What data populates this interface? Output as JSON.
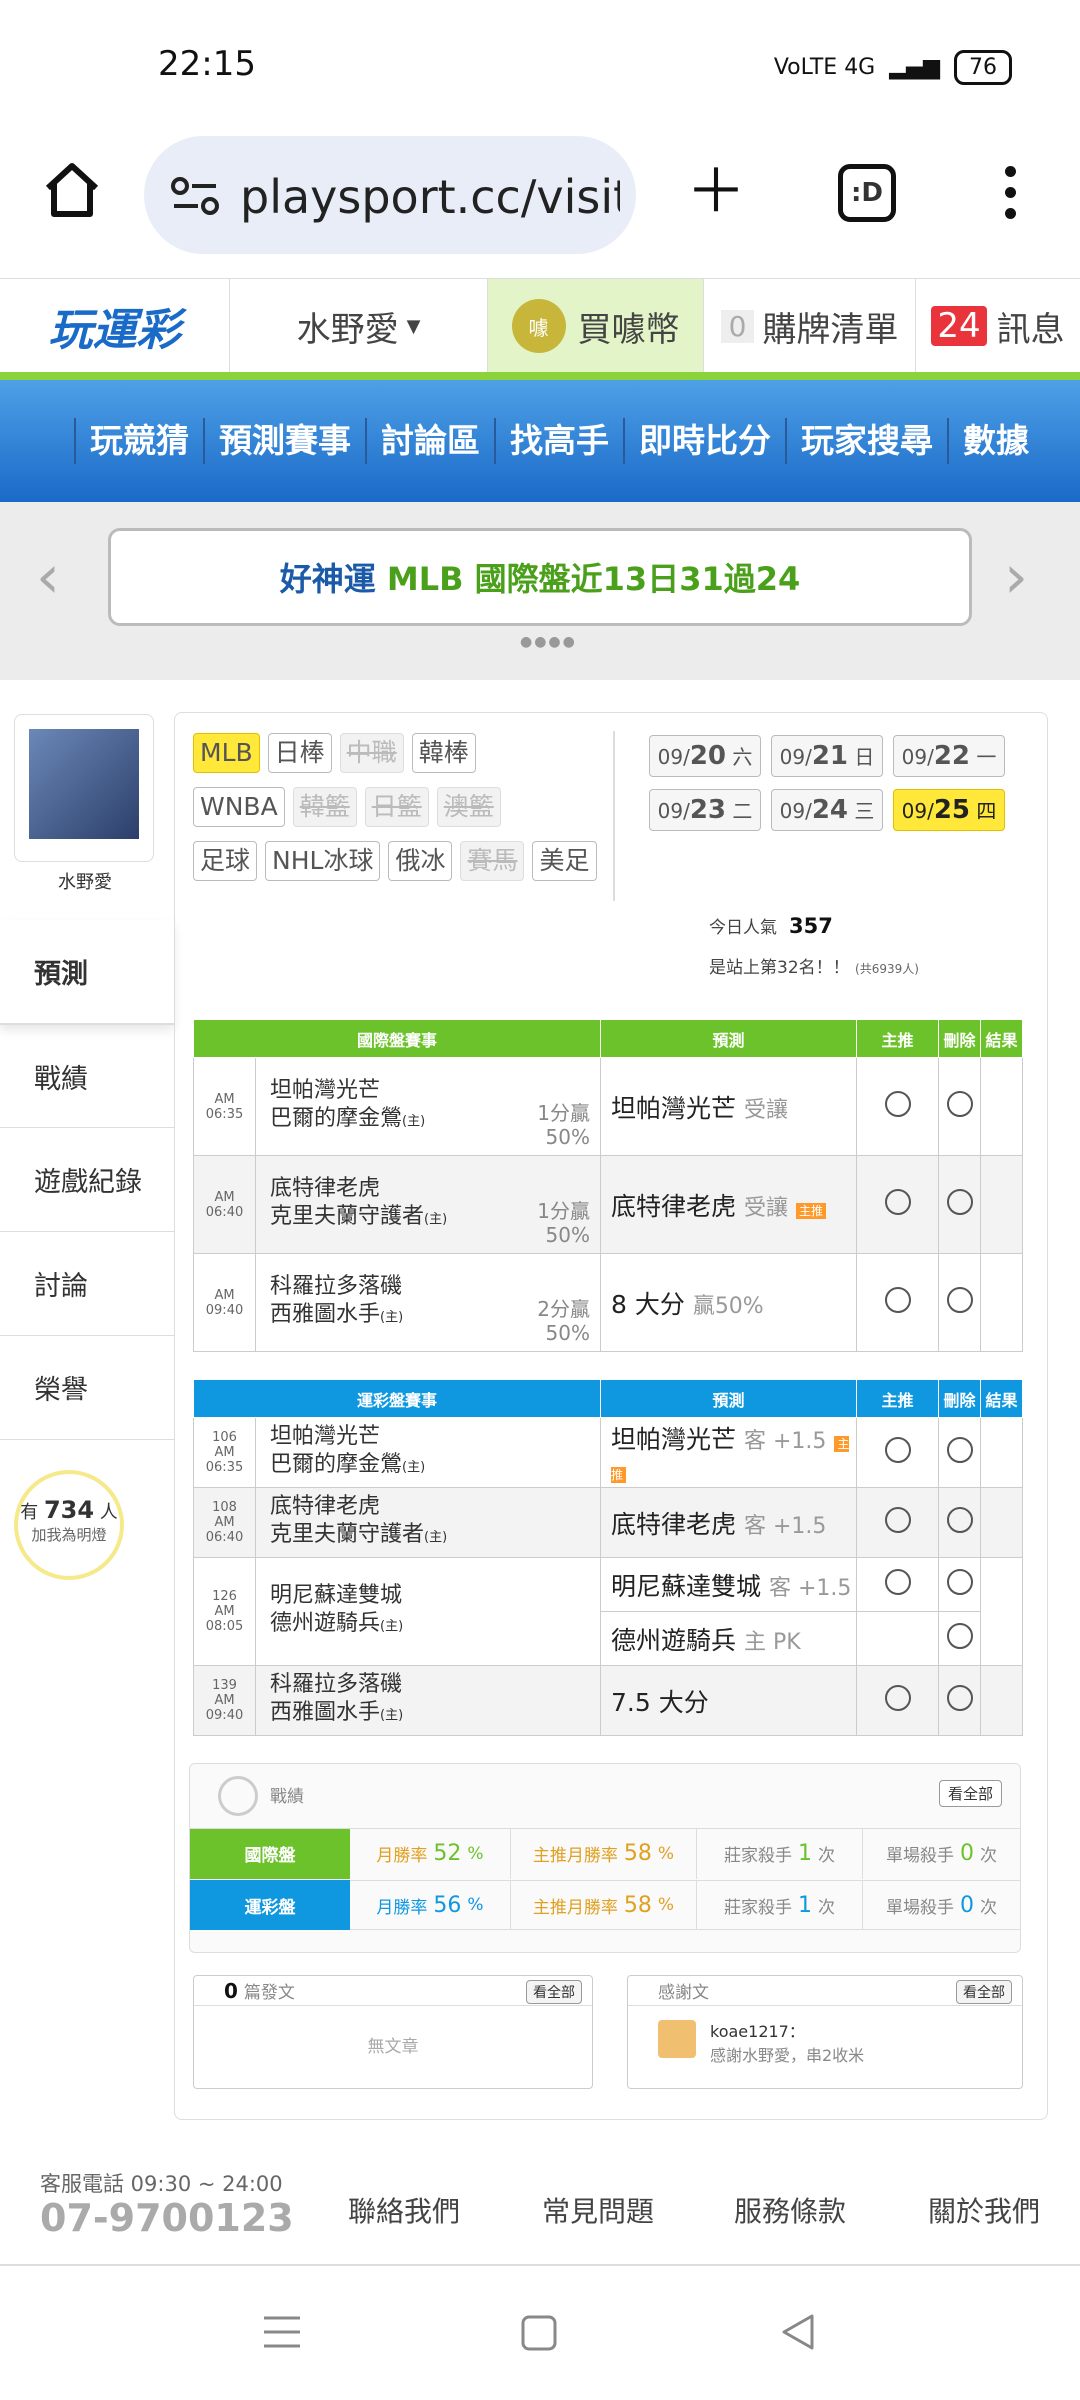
{
  "status_bar": {
    "time": "22:15",
    "network": "VoLTE 4G",
    "battery": "76"
  },
  "browser": {
    "url": "playsport.cc/visit",
    "tabs_label": ":D"
  },
  "header": {
    "logo": "玩運彩",
    "user_name": "水野愛",
    "coins_label": "買噱幣",
    "coins_badge": "噱",
    "cart_count": "0",
    "cart_label": "購牌清單",
    "msg_count": "24",
    "msg_label": "訊息"
  },
  "nav": [
    "玩競猜",
    "預測賽事",
    "討論區",
    "找高手",
    "即時比分",
    "玩家搜尋",
    "數據"
  ],
  "banner": {
    "text_a": "好神運",
    "text_b": "MLB 國際盤近13日31過24",
    "dots": "●●●●"
  },
  "profile": {
    "name": "水野愛"
  },
  "sidebar": [
    "預測",
    "戰績",
    "遊戲紀錄",
    "討論",
    "榮譽"
  ],
  "fans": {
    "prefix": "有",
    "count": "734",
    "suffix": "人",
    "line2": "加我為明燈"
  },
  "leagues": [
    {
      "label": "MLB",
      "state": "selected"
    },
    {
      "label": "日棒",
      "state": "normal"
    },
    {
      "label": "中職",
      "state": "disabled"
    },
    {
      "label": "韓棒",
      "state": "normal"
    },
    {
      "label": "WNBA",
      "state": "normal"
    },
    {
      "label": "韓籃",
      "state": "disabled"
    },
    {
      "label": "日籃",
      "state": "disabled"
    },
    {
      "label": "澳籃",
      "state": "disabled"
    },
    {
      "label": "足球",
      "state": "normal"
    },
    {
      "label": "NHL冰球",
      "state": "normal"
    },
    {
      "label": "俄冰",
      "state": "normal"
    },
    {
      "label": "賽馬",
      "state": "disabled"
    },
    {
      "label": "美足",
      "state": "normal"
    }
  ],
  "dates": [
    {
      "m": "09/",
      "d": "20",
      "w": "六"
    },
    {
      "m": "09/",
      "d": "21",
      "w": "日"
    },
    {
      "m": "09/",
      "d": "22",
      "w": "一"
    },
    {
      "m": "09/",
      "d": "23",
      "w": "二"
    },
    {
      "m": "09/",
      "d": "24",
      "w": "三"
    },
    {
      "m": "09/",
      "d": "25",
      "w": "四",
      "selected": true
    }
  ],
  "popularity": {
    "label": "今日人氣",
    "value": "357",
    "rank": "是站上第32名！！",
    "total": "(共6939人)"
  },
  "intl_table": {
    "headers": [
      "國際盤賽事",
      "預測",
      "主推",
      "刪除",
      "結果"
    ],
    "rows": [
      {
        "time": "AM 06:35",
        "away": "坦帕灣光芒",
        "home": "巴爾的摩金鶯",
        "home_tag": "(主)",
        "odds1": "1分贏",
        "odds2": "50%",
        "pred": "坦帕灣光芒",
        "pred_note": "受讓",
        "tag": ""
      },
      {
        "time": "AM 06:40",
        "away": "底特律老虎",
        "home": "克里夫蘭守護者",
        "home_tag": "(主)",
        "odds1": "1分贏",
        "odds2": "50%",
        "pred": "底特律老虎",
        "pred_note": "受讓",
        "tag": "主推"
      },
      {
        "time": "AM 09:40",
        "away": "科羅拉多落磯",
        "home": "西雅圖水手",
        "home_tag": "(主)",
        "odds1": "2分贏",
        "odds2": "50%",
        "pred": "8 大分",
        "pred_note": "贏50%",
        "tag": ""
      }
    ]
  },
  "lottery_table": {
    "headers": [
      "運彩盤賽事",
      "預測",
      "主推",
      "刪除",
      "結果"
    ],
    "rows": [
      {
        "num": "106",
        "time": "AM 06:35",
        "away": "坦帕灣光芒",
        "home": "巴爾的摩金鶯",
        "home_tag": "(主)",
        "preds": [
          {
            "pred": "坦帕灣光芒",
            "note": "客 +1.5",
            "tag": "主推"
          }
        ]
      },
      {
        "num": "108",
        "time": "AM 06:40",
        "away": "底特律老虎",
        "home": "克里夫蘭守護者",
        "home_tag": "(主)",
        "preds": [
          {
            "pred": "底特律老虎",
            "note": "客 +1.5",
            "tag": ""
          }
        ]
      },
      {
        "num": "126",
        "time": "AM 08:05",
        "away": "明尼蘇達雙城",
        "home": "德州遊騎兵",
        "home_tag": "(主)",
        "preds": [
          {
            "pred": "明尼蘇達雙城",
            "note": "客 +1.5",
            "tag": ""
          },
          {
            "pred": "德州遊騎兵",
            "note": "主 PK",
            "tag": ""
          }
        ]
      },
      {
        "num": "139",
        "time": "AM 09:40",
        "away": "科羅拉多落磯",
        "home": "西雅圖水手",
        "home_tag": "(主)",
        "preds": [
          {
            "pred": "7.5 大分",
            "note": "",
            "tag": ""
          }
        ]
      }
    ]
  },
  "record": {
    "title": "戰績",
    "view_all": "看全部",
    "rows": [
      {
        "label": "國際盤",
        "color": "#6cc22a",
        "month_rate_label": "月勝率",
        "month_rate": "52",
        "main_rate_label": "主推月勝率",
        "main_rate": "58",
        "killer_label": "莊家殺手",
        "killer": "1",
        "single_label": "單場殺手",
        "single": "0",
        "unit_pct": "%",
        "unit_times": "次"
      },
      {
        "label": "運彩盤",
        "color": "#0f98e0",
        "month_rate_label": "月勝率",
        "month_rate": "56",
        "main_rate_label": "主推月勝率",
        "main_rate": "58",
        "killer_label": "莊家殺手",
        "killer": "1",
        "single_label": "單場殺手",
        "single": "0",
        "unit_pct": "%",
        "unit_times": "次"
      }
    ]
  },
  "articles": {
    "count": "0",
    "label": "篇發文",
    "view_all": "看全部",
    "empty": "無文章"
  },
  "thanks": {
    "title": "感謝文",
    "view_all": "看全部",
    "user": "koae1217：",
    "text": "感謝水野愛，串2收米"
  },
  "footer": {
    "phone_label": "客服電話 09:30 ~ 24:00",
    "phone": "07-9700123",
    "links": [
      "聯絡我們",
      "常見問題",
      "服務條款",
      "關於我們"
    ]
  }
}
